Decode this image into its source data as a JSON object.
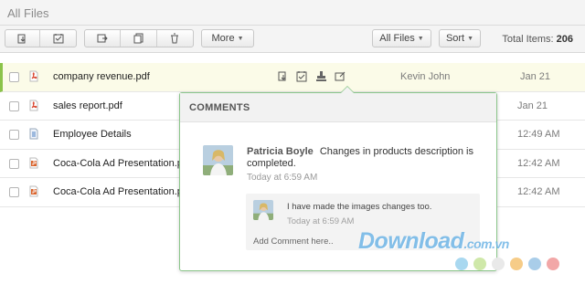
{
  "header": {
    "title": "All Files"
  },
  "toolbar": {
    "more_label": "More",
    "filter_label": "All Files",
    "sort_label": "Sort",
    "total_label": "Total Items:",
    "total_value": "206",
    "icons": [
      "download-icon",
      "share-icon",
      "send-icon",
      "copy-icon",
      "delete-icon"
    ]
  },
  "files": [
    {
      "name": "company revenue.pdf",
      "type": "pdf",
      "owner": "Kevin John",
      "date": "Jan 21",
      "selected": true
    },
    {
      "name": "sales report.pdf",
      "type": "pdf",
      "owner": "",
      "date": "Jan 21",
      "selected": false
    },
    {
      "name": "Employee Details",
      "type": "doc",
      "owner": "",
      "date": "12:49 AM",
      "selected": false
    },
    {
      "name": "Coca-Cola Ad Presentation.pp",
      "type": "ppt",
      "owner": "",
      "date": "12:42 AM",
      "selected": false
    },
    {
      "name": "Coca-Cola Ad Presentation.pp",
      "type": "ppt",
      "owner": "",
      "date": "12:42 AM",
      "selected": false
    }
  ],
  "comments": {
    "title": "COMMENTS",
    "author": "Patricia Boyle",
    "text": "Changes in products description is completed.",
    "time": "Today at 6:59 AM",
    "reply": {
      "text": "I have made the images changes too.",
      "time": "Today at 6:59 AM"
    },
    "add_placeholder": "Add Comment here.."
  },
  "watermark": {
    "main": "Download",
    "suffix": ".com.vn"
  },
  "colors": {
    "accent": "#8bc34a",
    "pdf": "#d9432c",
    "doc": "#4a7fc1",
    "ppt": "#d9632c",
    "watermark": "#5aaae1"
  }
}
